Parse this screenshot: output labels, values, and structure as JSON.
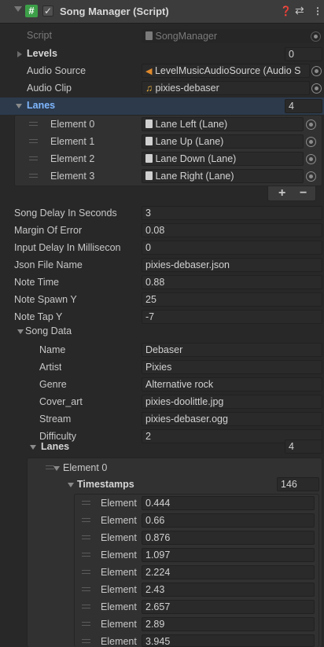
{
  "header": {
    "title": "Song Manager (Script)",
    "checked": true
  },
  "script": {
    "label": "Script",
    "value": "SongManager"
  },
  "levels": {
    "label": "Levels",
    "count": "0"
  },
  "audio_source": {
    "label": "Audio Source",
    "value": "LevelMusicAudioSource (Audio S"
  },
  "audio_clip": {
    "label": "Audio Clip",
    "value": "pixies-debaser"
  },
  "lanes": {
    "label": "Lanes",
    "count": "4",
    "elements": [
      {
        "label": "Element 0",
        "value": "Lane Left (Lane)"
      },
      {
        "label": "Element 1",
        "value": "Lane Up (Lane)"
      },
      {
        "label": "Element 2",
        "value": "Lane Down (Lane)"
      },
      {
        "label": "Element 3",
        "value": "Lane Right (Lane)"
      }
    ],
    "add": "+",
    "remove": "−"
  },
  "fields": [
    {
      "label": "Song Delay In Seconds",
      "value": "3"
    },
    {
      "label": "Margin Of Error",
      "value": "0.08"
    },
    {
      "label": "Input Delay In Millisecon",
      "value": "0"
    },
    {
      "label": "Json File Name",
      "value": "pixies-debaser.json"
    },
    {
      "label": "Note Time",
      "value": "0.88"
    },
    {
      "label": "Note Spawn Y",
      "value": "25"
    },
    {
      "label": "Note Tap Y",
      "value": "-7"
    }
  ],
  "song_data": {
    "label": "Song Data",
    "fields": [
      {
        "label": "Name",
        "value": "Debaser"
      },
      {
        "label": "Artist",
        "value": "Pixies"
      },
      {
        "label": "Genre",
        "value": "Alternative rock"
      },
      {
        "label": "Cover_art",
        "value": "pixies-doolittle.jpg"
      },
      {
        "label": "Stream",
        "value": "pixies-debaser.ogg"
      },
      {
        "label": "Difficulty",
        "value": "2"
      }
    ],
    "lanes": {
      "label": "Lanes",
      "count": "4",
      "element0": {
        "label": "Element 0",
        "timestamps": {
          "label": "Timestamps",
          "count": "146",
          "items": [
            {
              "label": "Element",
              "value": "0.444"
            },
            {
              "label": "Element",
              "value": "0.66"
            },
            {
              "label": "Element",
              "value": "0.876"
            },
            {
              "label": "Element",
              "value": "1.097"
            },
            {
              "label": "Element",
              "value": "2.224"
            },
            {
              "label": "Element",
              "value": "2.43"
            },
            {
              "label": "Element",
              "value": "2.657"
            },
            {
              "label": "Element",
              "value": "2.89"
            },
            {
              "label": "Element",
              "value": "3.945"
            }
          ]
        }
      }
    }
  },
  "colors": {
    "background": "#282828",
    "field": "#2a2a2a",
    "accent_blue": "#7fb7ff",
    "script_icon": "#3c9f48"
  }
}
